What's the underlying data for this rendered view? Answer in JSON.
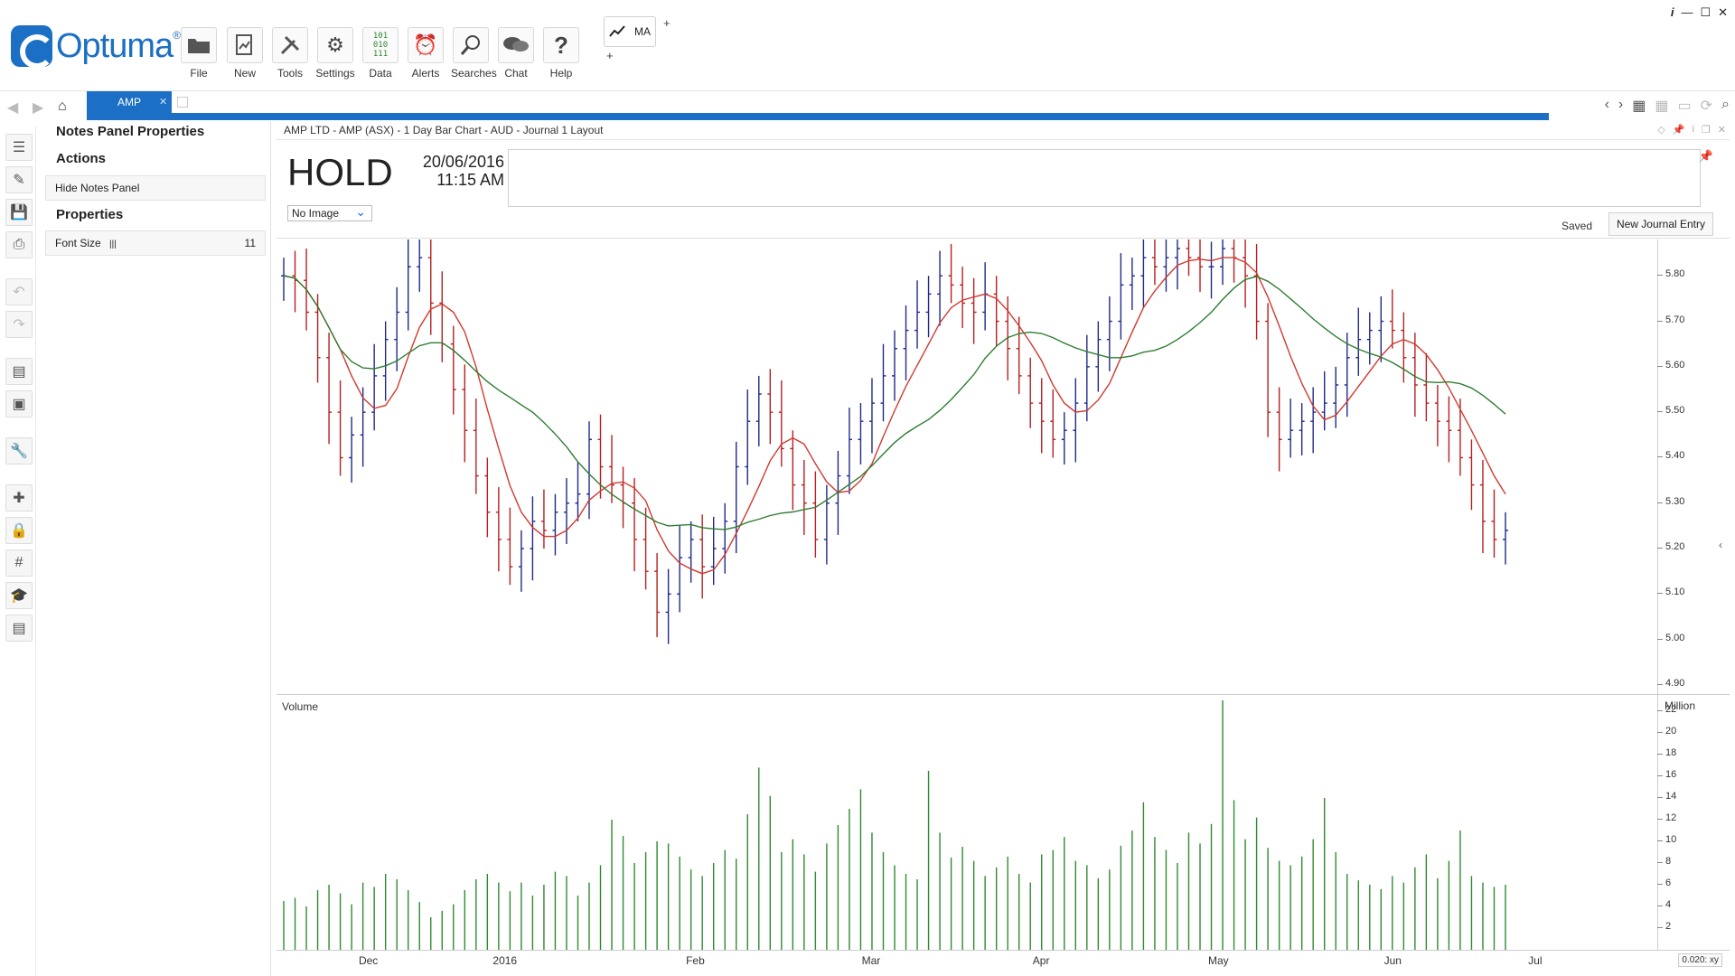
{
  "toolbar": {
    "logo_text": "Optuma",
    "logo_reg": "®",
    "buttons": [
      {
        "label": "File"
      },
      {
        "label": "New"
      },
      {
        "label": "Tools"
      },
      {
        "label": "Settings"
      },
      {
        "label": "Data"
      },
      {
        "label": "Alerts"
      },
      {
        "label": "Searches"
      },
      {
        "label": "Chat"
      },
      {
        "label": "Help"
      }
    ],
    "ma_label": "MA"
  },
  "tabs": [
    {
      "label": "AMP"
    }
  ],
  "notes_panel": {
    "title": "Notes Panel Properties",
    "actions_heading": "Actions",
    "hide_button": "Hide Notes Panel",
    "properties_heading": "Properties",
    "font_size_label": "Font Size",
    "font_size_value": "11"
  },
  "chart_window": {
    "title": "AMP LTD - AMP (ASX) - 1 Day Bar Chart - AUD - Journal 1 Layout",
    "journal": {
      "status": "HOLD",
      "date": "20/06/2016",
      "time": "11:15 AM",
      "image_select": "No Image",
      "saved_text": "Saved",
      "new_entry_button": "New Journal Entry"
    },
    "volume_label": "Volume",
    "volume_unit": "Million",
    "scale_readout": "0.020: xy"
  },
  "colors": {
    "accent": "#1b6fc5",
    "up_bar": "#1f2a8a",
    "down_bar": "#b52020",
    "ma_fast": "#d03a30",
    "ma_slow": "#2f7d32",
    "volume": "#2f8a2f"
  },
  "chart_data": {
    "type": "bar",
    "price_axis": {
      "ticks": [
        "5.80",
        "5.70",
        "5.60",
        "5.50",
        "5.40",
        "5.30",
        "5.20",
        "5.10",
        "5.00",
        "4.90"
      ],
      "ylim": [
        4.88,
        5.88
      ]
    },
    "volume_axis": {
      "ticks": [
        "22",
        "20",
        "18",
        "16",
        "14",
        "12",
        "10",
        "8",
        "6",
        "4",
        "2"
      ],
      "ylim": [
        0,
        23.5
      ]
    },
    "x_labels": [
      "Dec",
      "2016",
      "Feb",
      "Mar",
      "Apr",
      "May",
      "Jun",
      "Jul"
    ],
    "close": [
      5.8,
      5.79,
      5.72,
      5.62,
      5.5,
      5.4,
      5.45,
      5.5,
      5.58,
      5.66,
      5.72,
      5.82,
      5.84,
      5.74,
      5.65,
      5.55,
      5.46,
      5.36,
      5.28,
      5.22,
      5.16,
      5.2,
      5.26,
      5.24,
      5.28,
      5.3,
      5.32,
      5.44,
      5.38,
      5.34,
      5.3,
      5.22,
      5.15,
      5.06,
      5.1,
      5.18,
      5.22,
      5.16,
      5.2,
      5.26,
      5.38,
      5.48,
      5.54,
      5.5,
      5.42,
      5.34,
      5.3,
      5.22,
      5.3,
      5.36,
      5.44,
      5.48,
      5.52,
      5.58,
      5.64,
      5.68,
      5.72,
      5.76,
      5.8,
      5.78,
      5.74,
      5.72,
      5.76,
      5.7,
      5.64,
      5.58,
      5.52,
      5.48,
      5.44,
      5.46,
      5.52,
      5.6,
      5.66,
      5.7,
      5.78,
      5.8,
      5.84,
      5.82,
      5.84,
      5.86,
      5.84,
      5.82,
      5.82,
      5.86,
      5.84,
      5.8,
      5.7,
      5.5,
      5.44,
      5.46,
      5.48,
      5.5,
      5.52,
      5.56,
      5.62,
      5.66,
      5.68,
      5.7,
      5.68,
      5.62,
      5.56,
      5.52,
      5.48,
      5.46,
      5.4,
      5.34,
      5.26,
      5.22,
      5.24
    ],
    "volume": [
      4.5,
      4.8,
      4.0,
      5.5,
      6.0,
      5.2,
      4.2,
      6.2,
      5.8,
      7.0,
      6.5,
      5.5,
      4.4,
      3.0,
      3.6,
      4.2,
      5.5,
      6.5,
      7.0,
      6.2,
      5.4,
      6.2,
      5.0,
      6.0,
      7.2,
      6.8,
      5.0,
      6.2,
      7.8,
      12.0,
      10.5,
      8.0,
      9.0,
      10.0,
      9.8,
      8.6,
      7.4,
      6.8,
      8.0,
      9.2,
      8.4,
      12.5,
      16.8,
      14.2,
      9.0,
      10.2,
      8.8,
      7.2,
      9.8,
      11.5,
      13.0,
      14.8,
      10.8,
      9.0,
      7.8,
      7.0,
      6.5,
      16.5,
      10.8,
      8.5,
      9.5,
      8.2,
      6.8,
      7.6,
      8.6,
      7.0,
      6.2,
      8.8,
      9.2,
      10.4,
      8.2,
      7.8,
      6.6,
      7.4,
      9.6,
      11.0,
      13.6,
      10.4,
      9.2,
      8.0,
      10.8,
      9.8,
      11.6,
      23.0,
      13.8,
      10.2,
      12.2,
      9.4,
      8.2,
      7.8,
      8.6,
      10.2,
      14.0,
      9.0,
      7.0,
      6.4,
      6.0,
      5.6,
      6.8,
      6.2,
      7.6,
      8.8,
      6.6,
      8.2,
      11.0,
      6.8,
      6.2,
      5.8,
      6.0
    ]
  }
}
